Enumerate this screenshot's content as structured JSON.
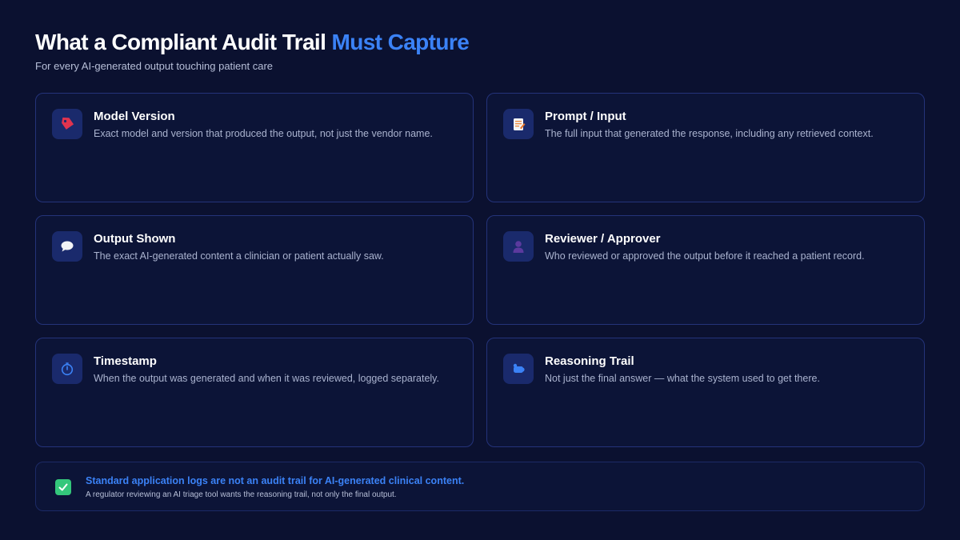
{
  "header": {
    "title_main": "What a Compliant Audit Trail ",
    "title_accent": "Must Capture",
    "subtitle": "For every AI-generated output touching patient care"
  },
  "cards": [
    {
      "title": "Model Version",
      "description": "Exact model and version that produced the output, not just the vendor name.",
      "icon": "tag-icon"
    },
    {
      "title": "Prompt / Input",
      "description": "The full input that generated the response, including any retrieved context.",
      "icon": "memo-icon"
    },
    {
      "title": "Output Shown",
      "description": "The exact AI-generated content a clinician or patient actually saw.",
      "icon": "speech-bubble-icon"
    },
    {
      "title": "Reviewer / Approver",
      "description": "Who reviewed or approved the output before it reached a patient record.",
      "icon": "person-icon"
    },
    {
      "title": "Timestamp",
      "description": "When the output was generated and when it was reviewed, logged separately.",
      "icon": "stopwatch-icon"
    },
    {
      "title": "Reasoning Trail",
      "description": "Not just the final answer — what the system used to get there.",
      "icon": "thought-trail-icon"
    }
  ],
  "callout": {
    "title": "Standard application logs are not an audit trail for AI-generated clinical content.",
    "subtitle": "A regulator reviewing an AI triage tool wants the reasoning trail, not only the final output.",
    "icon": "check-icon"
  },
  "colors": {
    "background": "#0b1130",
    "accent": "#3b82f6",
    "card_border": "#24337a",
    "check_green": "#34c77b"
  }
}
